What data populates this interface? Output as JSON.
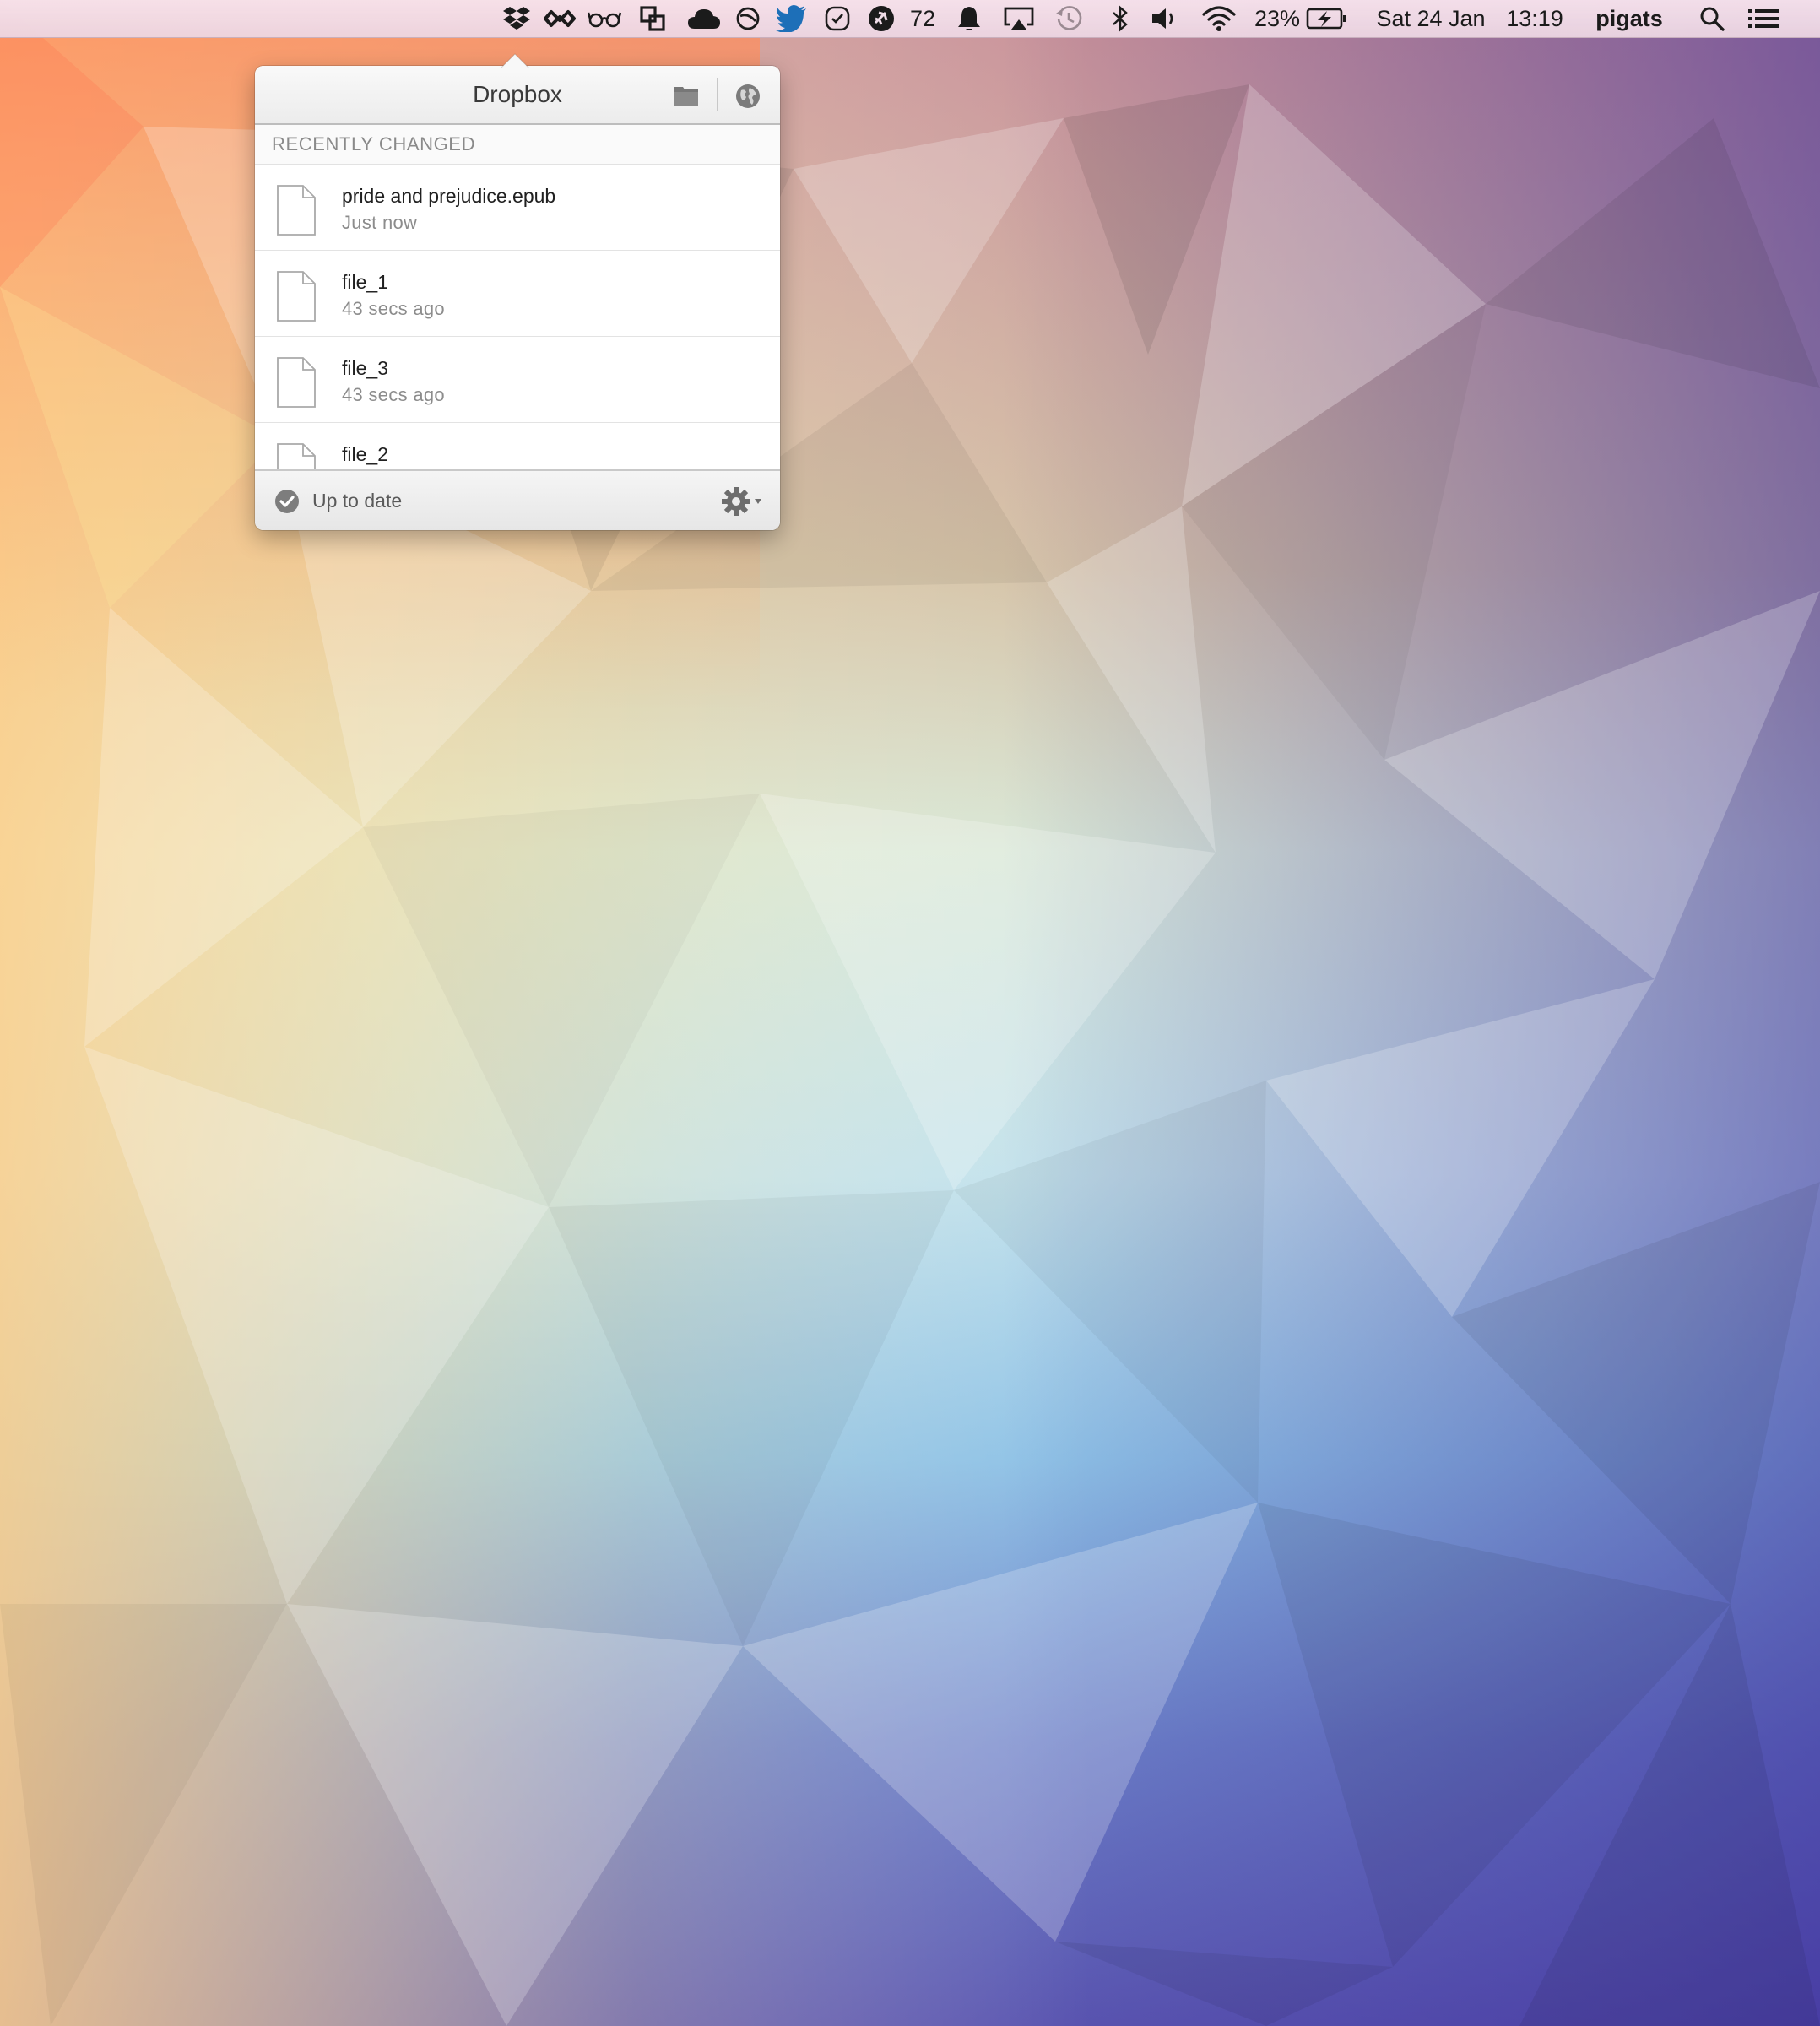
{
  "menubar": {
    "notification_count": "72",
    "battery_percent": "23%",
    "date": "Sat 24 Jan",
    "time": "13:19",
    "user": "pigats",
    "icons": [
      "dropbox-icon",
      "infinity-icon",
      "glasses-icon",
      "copy-windows-icon",
      "cloud-icon",
      "circle-slash-icon",
      "twitter-icon",
      "task-check-icon",
      "airplane-icon",
      "bell-icon",
      "airplay-icon",
      "time-machine-icon",
      "bluetooth-icon",
      "volume-icon",
      "wifi-icon",
      "battery-charging-icon",
      "spotlight-search-icon",
      "notification-center-icon"
    ]
  },
  "popover": {
    "title": "Dropbox",
    "section_title": "RECENTLY CHANGED",
    "files": [
      {
        "name": "pride and prejudice.epub",
        "time": "Just now"
      },
      {
        "name": "file_1",
        "time": "43 secs ago"
      },
      {
        "name": "file_3",
        "time": "43 secs ago"
      },
      {
        "name": "file_2",
        "time": ""
      }
    ],
    "status": "Up to date",
    "header_icons": [
      "folder-icon",
      "globe-icon"
    ],
    "footer_icons": [
      "checkmark-circle-icon",
      "gear-icon"
    ]
  },
  "colors": {
    "menubar_bg": "#f2dde8",
    "twitter_blue": "#1d6fb8",
    "popover_bg": "#ffffff",
    "secondary_text": "#8c8c8c"
  }
}
